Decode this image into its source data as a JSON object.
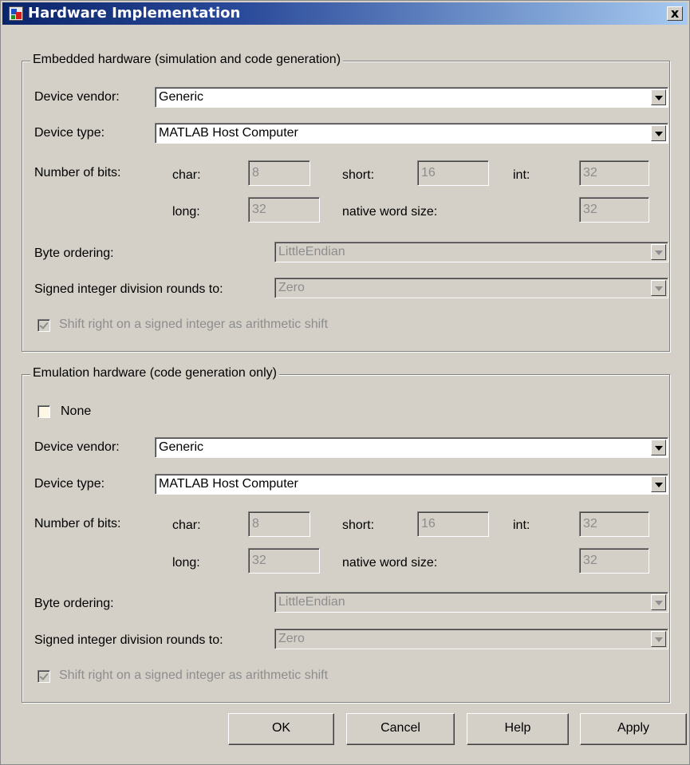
{
  "window": {
    "title": "Hardware Implementation",
    "close_label": "x"
  },
  "embedded": {
    "legend": "Embedded hardware (simulation and code generation)",
    "vendor_label": "Device vendor:",
    "vendor_value": "Generic",
    "type_label": "Device type:",
    "type_value": "MATLAB Host Computer",
    "bits_label": "Number of bits:",
    "char_label": "char:",
    "char_value": "8",
    "short_label": "short:",
    "short_value": "16",
    "int_label": "int:",
    "int_value": "32",
    "long_label": "long:",
    "long_value": "32",
    "native_label": "native word size:",
    "native_value": "32",
    "byte_label": "Byte ordering:",
    "byte_value": "LittleEndian",
    "division_label": "Signed integer division rounds to:",
    "division_value": "Zero",
    "shift_label": "Shift right on a signed integer as arithmetic shift",
    "shift_checked": true
  },
  "emulation": {
    "legend": "Emulation hardware (code generation only)",
    "none_label": "None",
    "none_checked": false,
    "vendor_label": "Device vendor:",
    "vendor_value": "Generic",
    "type_label": "Device type:",
    "type_value": "MATLAB Host Computer",
    "bits_label": "Number of bits:",
    "char_label": "char:",
    "char_value": "8",
    "short_label": "short:",
    "short_value": "16",
    "int_label": "int:",
    "int_value": "32",
    "long_label": "long:",
    "long_value": "32",
    "native_label": "native word size:",
    "native_value": "32",
    "byte_label": "Byte ordering:",
    "byte_value": "LittleEndian",
    "division_label": "Signed integer division rounds to:",
    "division_value": "Zero",
    "shift_label": "Shift right on a signed integer as arithmetic shift",
    "shift_checked": true
  },
  "buttons": {
    "ok": "OK",
    "cancel": "Cancel",
    "help": "Help",
    "apply": "Apply"
  }
}
